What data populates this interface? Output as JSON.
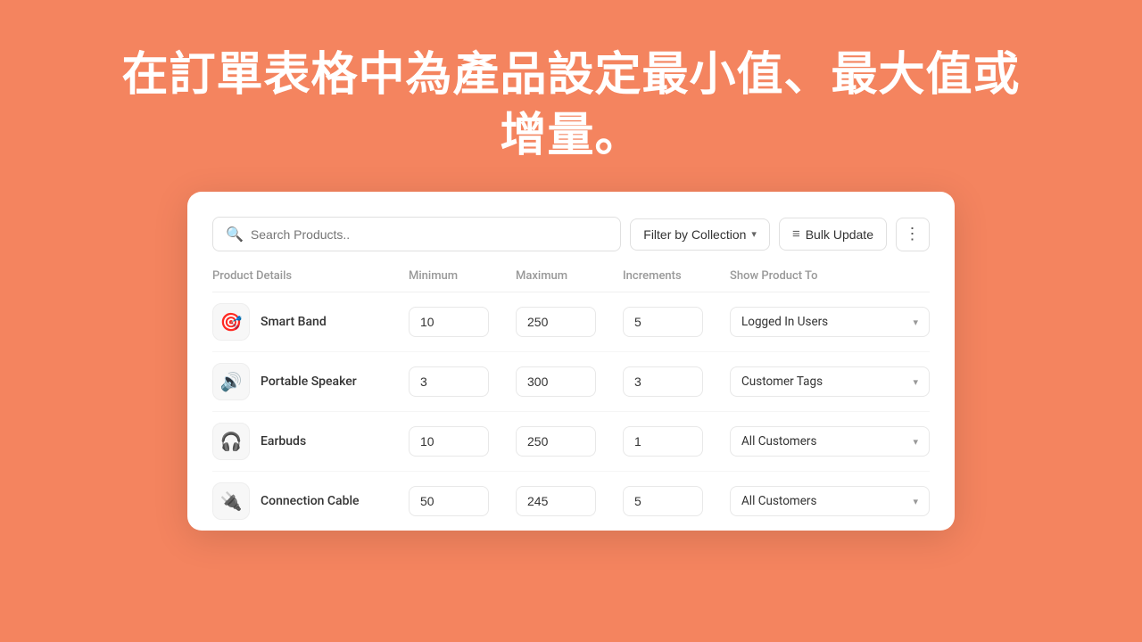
{
  "hero": {
    "title": "在訂單表格中為產品設定最小值、最大值或增量。"
  },
  "toolbar": {
    "search_placeholder": "Search Products..",
    "filter_label": "Filter by Collection",
    "bulk_label": "Bulk Update",
    "more_label": "⋮"
  },
  "table": {
    "headers": {
      "product": "Product Details",
      "minimum": "Minimum",
      "maximum": "Maximum",
      "increments": "Increments",
      "show_to": "Show Product To"
    },
    "rows": [
      {
        "id": "smart-band",
        "name": "Smart Band",
        "min": "10",
        "max": "250",
        "inc": "5",
        "show_to": "Logged In Users",
        "emoji": "🎯"
      },
      {
        "id": "portable-speaker",
        "name": "Portable Speaker",
        "min": "3",
        "max": "300",
        "inc": "3",
        "show_to": "Customer Tags",
        "emoji": "🔊"
      },
      {
        "id": "earbuds",
        "name": "Earbuds",
        "min": "10",
        "max": "250",
        "inc": "1",
        "show_to": "All Customers",
        "emoji": "🎧"
      },
      {
        "id": "connection-cable",
        "name": "Connection Cable",
        "min": "50",
        "max": "245",
        "inc": "5",
        "show_to": "All Customers",
        "emoji": "🔌"
      }
    ]
  }
}
